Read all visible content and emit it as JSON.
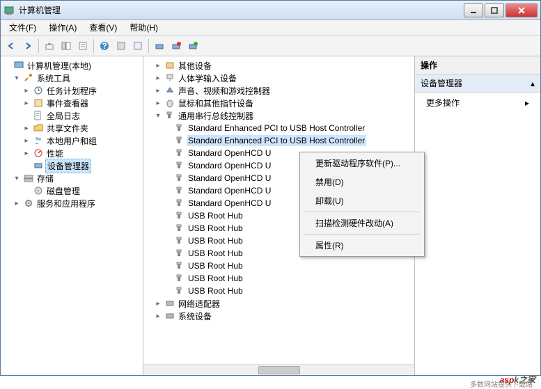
{
  "window": {
    "title": "计算机管理"
  },
  "menubar": [
    "文件(F)",
    "操作(A)",
    "查看(V)",
    "帮助(H)"
  ],
  "leftTree": {
    "root": "计算机管理(本地)",
    "systemTools": {
      "label": "系统工具",
      "children": [
        "任务计划程序",
        "事件查看器",
        "全局日志",
        "共享文件夹",
        "本地用户和组",
        "性能",
        "设备管理器"
      ]
    },
    "storage": {
      "label": "存储",
      "children": [
        "磁盘管理"
      ]
    },
    "services": {
      "label": "服务和应用程序"
    }
  },
  "midTree": {
    "categories": [
      "其他设备",
      "人体学输入设备",
      "声音、视频和游戏控制器",
      "鼠标和其他指针设备"
    ],
    "usbCategory": "通用串行总线控制器",
    "usbDevices": [
      "Standard Enhanced PCI to USB Host Controller",
      "Standard Enhanced PCI to USB Host Controller",
      "Standard OpenHCD U",
      "Standard OpenHCD U",
      "Standard OpenHCD U",
      "Standard OpenHCD U",
      "Standard OpenHCD U",
      "USB Root Hub",
      "USB Root Hub",
      "USB Root Hub",
      "USB Root Hub",
      "USB Root Hub",
      "USB Root Hub",
      "USB Root Hub"
    ],
    "after": [
      "网络适配器",
      "系统设备"
    ]
  },
  "contextMenu": {
    "items": [
      "更新驱动程序软件(P)...",
      "禁用(D)",
      "卸载(U)"
    ],
    "items2": [
      "扫描检测硬件改动(A)"
    ],
    "items3": [
      "属性(R)"
    ]
  },
  "rightPane": {
    "header": "操作",
    "section": "设备管理器",
    "more": "更多操作"
  },
  "watermark": {
    "a": "asp",
    "b": "k之家",
    "sub": "多数网站提供下载站"
  }
}
